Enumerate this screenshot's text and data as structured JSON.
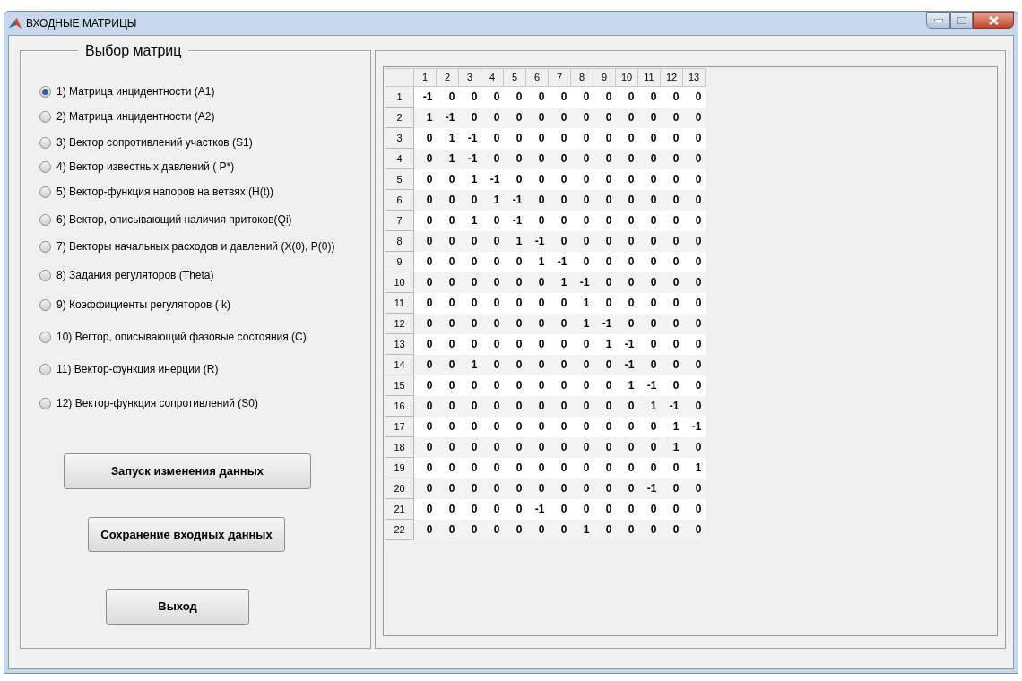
{
  "window": {
    "title": "ВХОДНЫЕ МАТРИЦЫ"
  },
  "panel": {
    "title": "Выбор матриц",
    "options": [
      {
        "label": "1) Матрица инцидентности (A1)",
        "selected": true
      },
      {
        "label": "2) Матрица инцидентности (A2)",
        "selected": false
      },
      {
        "label": "3) Вектор сопротивлений участков (S1)",
        "selected": false
      },
      {
        "label": "4) Вектор известных давлений ( P*)",
        "selected": false
      },
      {
        "label": "5) Вектор-функция напоров на ветвях (H(t))",
        "selected": false
      },
      {
        "label": "6) Вектор, описывающий наличия притоков(Qi)",
        "selected": false
      },
      {
        "label": "7) Векторы начальных расходов и давлений (X(0), P(0))",
        "selected": false
      },
      {
        "label": "8) Задания регуляторов (Theta)",
        "selected": false
      },
      {
        "label": "9) Коэффициенты регуляторов ( k)",
        "selected": false
      },
      {
        "label": "10) Вегтор, описывающий  фазовые состояния (C)",
        "selected": false
      },
      {
        "label": "11) Вектор-функция инерции (R)",
        "selected": false
      },
      {
        "label": "12) Вектор-функция сопротивлений (S0)",
        "selected": false
      }
    ],
    "buttons": [
      "Запуск изменения данных",
      "Сохранение входных данных",
      "Выход"
    ]
  },
  "table": {
    "columns": [
      "1",
      "2",
      "3",
      "4",
      "5",
      "6",
      "7",
      "8",
      "9",
      "10",
      "11",
      "12",
      "13"
    ],
    "rows": [
      {
        "header": "1",
        "cells": [
          "-1",
          "0",
          "0",
          "0",
          "0",
          "0",
          "0",
          "0",
          "0",
          "0",
          "0",
          "0",
          "0"
        ]
      },
      {
        "header": "2",
        "cells": [
          "1",
          "-1",
          "0",
          "0",
          "0",
          "0",
          "0",
          "0",
          "0",
          "0",
          "0",
          "0",
          "0"
        ]
      },
      {
        "header": "3",
        "cells": [
          "0",
          "1",
          "-1",
          "0",
          "0",
          "0",
          "0",
          "0",
          "0",
          "0",
          "0",
          "0",
          "0"
        ]
      },
      {
        "header": "4",
        "cells": [
          "0",
          "1",
          "-1",
          "0",
          "0",
          "0",
          "0",
          "0",
          "0",
          "0",
          "0",
          "0",
          "0"
        ]
      },
      {
        "header": "5",
        "cells": [
          "0",
          "0",
          "1",
          "-1",
          "0",
          "0",
          "0",
          "0",
          "0",
          "0",
          "0",
          "0",
          "0"
        ]
      },
      {
        "header": "6",
        "cells": [
          "0",
          "0",
          "0",
          "1",
          "-1",
          "0",
          "0",
          "0",
          "0",
          "0",
          "0",
          "0",
          "0"
        ]
      },
      {
        "header": "7",
        "cells": [
          "0",
          "0",
          "1",
          "0",
          "-1",
          "0",
          "0",
          "0",
          "0",
          "0",
          "0",
          "0",
          "0"
        ]
      },
      {
        "header": "8",
        "cells": [
          "0",
          "0",
          "0",
          "0",
          "1",
          "-1",
          "0",
          "0",
          "0",
          "0",
          "0",
          "0",
          "0"
        ]
      },
      {
        "header": "9",
        "cells": [
          "0",
          "0",
          "0",
          "0",
          "0",
          "1",
          "-1",
          "0",
          "0",
          "0",
          "0",
          "0",
          "0"
        ]
      },
      {
        "header": "10",
        "cells": [
          "0",
          "0",
          "0",
          "0",
          "0",
          "0",
          "1",
          "-1",
          "0",
          "0",
          "0",
          "0",
          "0"
        ]
      },
      {
        "header": "11",
        "cells": [
          "0",
          "0",
          "0",
          "0",
          "0",
          "0",
          "0",
          "1",
          "0",
          "0",
          "0",
          "0",
          "0"
        ]
      },
      {
        "header": "12",
        "cells": [
          "0",
          "0",
          "0",
          "0",
          "0",
          "0",
          "0",
          "1",
          "-1",
          "0",
          "0",
          "0",
          "0"
        ]
      },
      {
        "header": "13",
        "cells": [
          "0",
          "0",
          "0",
          "0",
          "0",
          "0",
          "0",
          "0",
          "1",
          "-1",
          "0",
          "0",
          "0"
        ]
      },
      {
        "header": "14",
        "cells": [
          "0",
          "0",
          "1",
          "0",
          "0",
          "0",
          "0",
          "0",
          "0",
          "-1",
          "0",
          "0",
          "0"
        ]
      },
      {
        "header": "15",
        "cells": [
          "0",
          "0",
          "0",
          "0",
          "0",
          "0",
          "0",
          "0",
          "0",
          "1",
          "-1",
          "0",
          "0"
        ]
      },
      {
        "header": "16",
        "cells": [
          "0",
          "0",
          "0",
          "0",
          "0",
          "0",
          "0",
          "0",
          "0",
          "0",
          "1",
          "-1",
          "0"
        ]
      },
      {
        "header": "17",
        "cells": [
          "0",
          "0",
          "0",
          "0",
          "0",
          "0",
          "0",
          "0",
          "0",
          "0",
          "0",
          "1",
          "-1"
        ]
      },
      {
        "header": "18",
        "cells": [
          "0",
          "0",
          "0",
          "0",
          "0",
          "0",
          "0",
          "0",
          "0",
          "0",
          "0",
          "1",
          "0"
        ]
      },
      {
        "header": "19",
        "cells": [
          "0",
          "0",
          "0",
          "0",
          "0",
          "0",
          "0",
          "0",
          "0",
          "0",
          "0",
          "0",
          "1"
        ]
      },
      {
        "header": "20",
        "cells": [
          "0",
          "0",
          "0",
          "0",
          "0",
          "0",
          "0",
          "0",
          "0",
          "0",
          "-1",
          "0",
          "0"
        ]
      },
      {
        "header": "21",
        "cells": [
          "0",
          "0",
          "0",
          "0",
          "0",
          "-1",
          "0",
          "0",
          "0",
          "0",
          "0",
          "0",
          "0"
        ]
      },
      {
        "header": "22",
        "cells": [
          "0",
          "0",
          "0",
          "0",
          "0",
          "0",
          "0",
          "1",
          "0",
          "0",
          "0",
          "0",
          "0"
        ]
      }
    ]
  }
}
